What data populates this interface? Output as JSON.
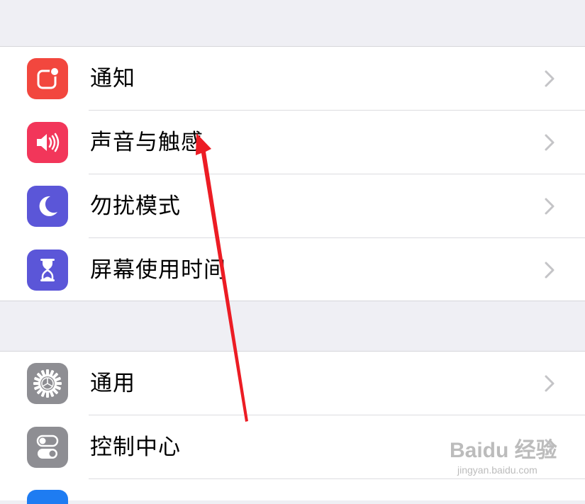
{
  "settings_group_1": [
    {
      "label": "通知",
      "icon": "notifications-icon",
      "color": "#f2473e"
    },
    {
      "label": "声音与触感",
      "icon": "sounds-icon",
      "color": "#f2365a"
    },
    {
      "label": "勿扰模式",
      "icon": "moon-icon",
      "color": "#5b56d8"
    },
    {
      "label": "屏幕使用时间",
      "icon": "hourglass-icon",
      "color": "#5b56d8"
    }
  ],
  "settings_group_2": [
    {
      "label": "通用",
      "icon": "gear-icon",
      "color": "#8e8e93"
    },
    {
      "label": "控制中心",
      "icon": "toggles-icon",
      "color": "#8e8e93"
    }
  ],
  "partial_icon_color": "#1e7cf2",
  "annotation_arrow_color": "#ec1c24",
  "watermark": {
    "brand": "Baidu 经验",
    "url": "jingyan.baidu.com"
  }
}
